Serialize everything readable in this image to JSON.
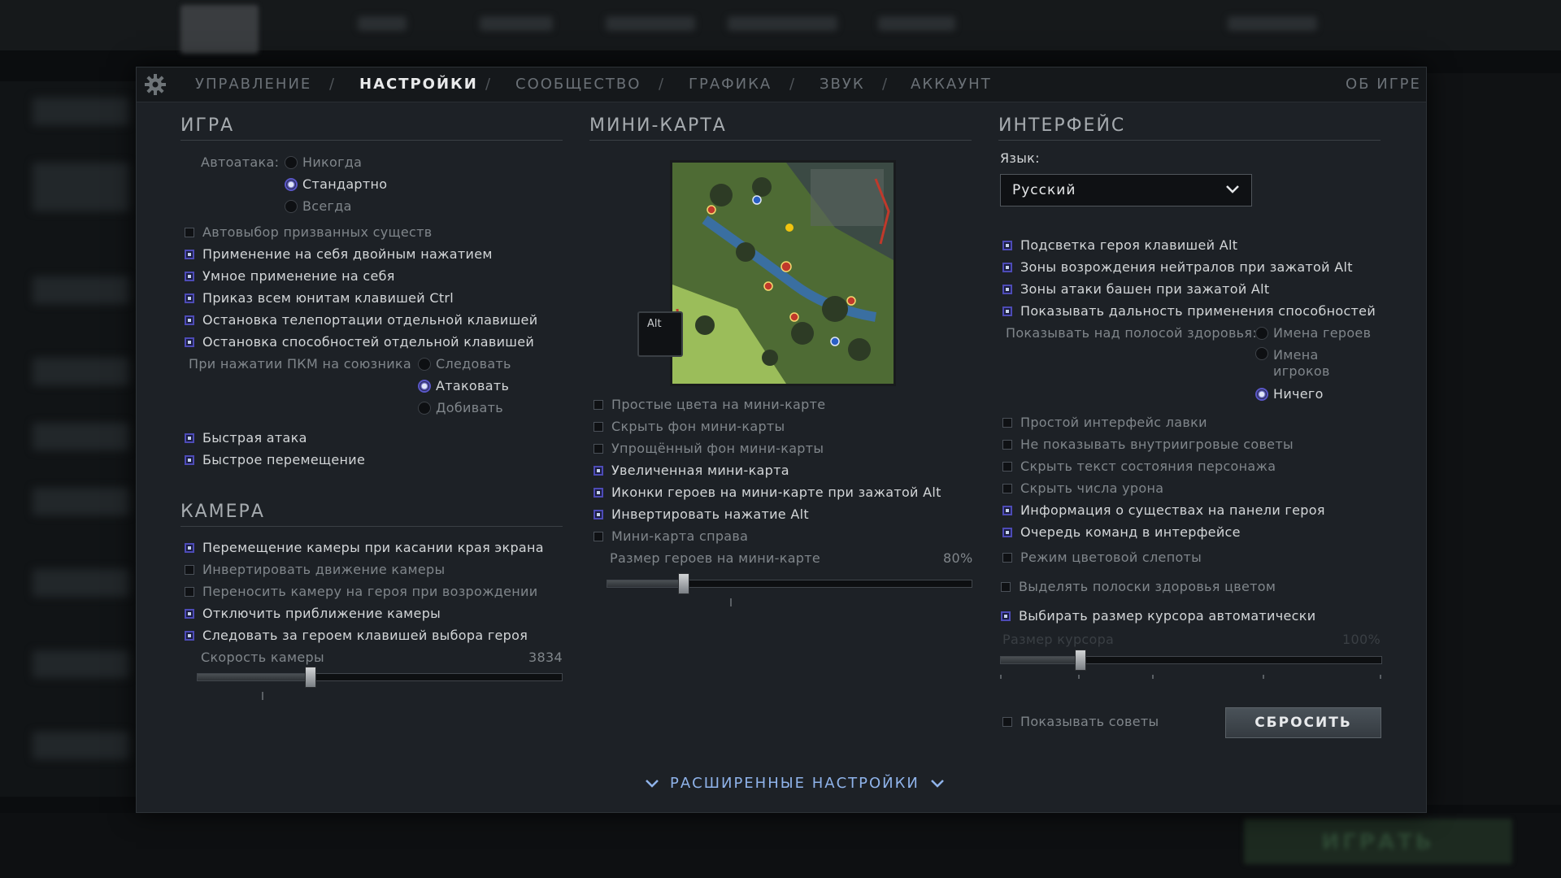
{
  "app": {
    "play_button": "ИГРАТЬ"
  },
  "tabs": {
    "items": [
      {
        "label": "УПРАВЛЕНИЕ",
        "active": false
      },
      {
        "label": "НАСТРОЙКИ",
        "active": true
      },
      {
        "label": "СООБЩЕСТВО",
        "active": false
      },
      {
        "label": "ГРАФИКА",
        "active": false
      },
      {
        "label": "ЗВУК",
        "active": false
      },
      {
        "label": "АККАУНТ",
        "active": false
      }
    ],
    "separator": "/",
    "about": "ОБ ИГРЕ"
  },
  "game": {
    "title": "ИГРА",
    "autoattack_label": "Автоатака:",
    "autoattack_options": [
      {
        "label": "Никогда",
        "selected": false
      },
      {
        "label": "Стандартно",
        "selected": true
      },
      {
        "label": "Всегда",
        "selected": false
      }
    ],
    "checks": [
      {
        "label": "Автовыбор призванных существ",
        "checked": false
      },
      {
        "label": "Применение на себя двойным нажатием",
        "checked": true
      },
      {
        "label": "Умное применение на себя",
        "checked": true
      },
      {
        "label": "Приказ всем юнитам клавишей Ctrl",
        "checked": true
      },
      {
        "label": "Остановка телепортации отдельной клавишей",
        "checked": true
      },
      {
        "label": "Остановка способностей отдельной клавишей",
        "checked": true
      }
    ],
    "rmb_label": "При нажатии ПКМ на союзника",
    "rmb_options": [
      {
        "label": "Следовать",
        "selected": false
      },
      {
        "label": "Атаковать",
        "selected": true
      },
      {
        "label": "Добивать",
        "selected": false
      }
    ],
    "checks2": [
      {
        "label": "Быстрая атака",
        "checked": true
      },
      {
        "label": "Быстрое перемещение",
        "checked": true
      }
    ]
  },
  "camera": {
    "title": "КАМЕРА",
    "checks": [
      {
        "label": "Перемещение камеры при касании края экрана",
        "checked": true
      },
      {
        "label": "Инвертировать движение камеры",
        "checked": false
      },
      {
        "label": "Переносить камеру на героя при возрождении",
        "checked": false
      },
      {
        "label": "Отключить приближение камеры",
        "checked": true
      },
      {
        "label": "Следовать за героем клавишей выбора героя",
        "checked": true
      }
    ],
    "speed_label": "Скорость камеры",
    "speed_value": "3834",
    "speed_fraction": 0.31
  },
  "minimap": {
    "title": "МИНИ-КАРТА",
    "alt_key": "Alt",
    "checks": [
      {
        "label": "Простые цвета на мини-карте",
        "checked": false
      },
      {
        "label": "Скрыть фон мини-карты",
        "checked": false
      },
      {
        "label": "Упрощённый фон мини-карты",
        "checked": false
      },
      {
        "label": "Увеличенная мини-карта",
        "checked": true
      },
      {
        "label": "Иконки героев на мини-карте при зажатой Alt",
        "checked": true
      },
      {
        "label": "Инвертировать нажатие Alt",
        "checked": true
      },
      {
        "label": "Мини-карта справа",
        "checked": false
      }
    ],
    "hero_size_label": "Размер героев на мини-карте",
    "hero_size_value": "80%",
    "hero_size_fraction": 0.21
  },
  "interface": {
    "title": "ИНТЕРФЕЙС",
    "language_label": "Язык:",
    "language_value": "Русский",
    "checks": [
      {
        "label": "Подсветка героя клавишей Alt",
        "checked": true
      },
      {
        "label": "Зоны возрождения нейтралов при зажатой Alt",
        "checked": true
      },
      {
        "label": "Зоны атаки башен при зажатой Alt",
        "checked": true
      },
      {
        "label": "Показывать дальность применения способностей",
        "checked": true
      }
    ],
    "healthbar_label": "Показывать над полосой здоровья:",
    "healthbar_options": [
      {
        "label": "Имена героев",
        "selected": false
      },
      {
        "label": "Имена игроков",
        "selected": false
      },
      {
        "label": "Ничего",
        "selected": true
      }
    ],
    "checks2": [
      {
        "label": "Простой интерфейс лавки",
        "checked": false
      },
      {
        "label": "Не показывать внутриигровые советы",
        "checked": false
      },
      {
        "label": "Скрыть текст состояния персонажа",
        "checked": false
      },
      {
        "label": "Скрыть числа урона",
        "checked": false
      },
      {
        "label": "Информация о существах на панели героя",
        "checked": true
      },
      {
        "label": "Очередь команд в интерфейсе",
        "checked": true
      },
      {
        "label": "Режим цветовой слепоты",
        "checked": false
      },
      {
        "label": "Выделять полоски здоровья цветом",
        "checked": false
      },
      {
        "label": "Выбирать размер курсора автоматически",
        "checked": true
      }
    ],
    "cursor_size_label": "Размер курсора",
    "cursor_size_value": "100%",
    "cursor_size_fraction": 0.21,
    "show_tips_label": "Показывать советы",
    "show_tips_checked": false,
    "reset_button": "СБРОСИТЬ"
  },
  "advanced": {
    "label": "РАСШИРЕННЫЕ НАСТРОЙКИ"
  },
  "icons": {
    "settings": "gear-icon",
    "dropdown": "chevron-down-icon",
    "advanced": "chevron-down-icon"
  },
  "colors": {
    "accent": "#8fb3ea",
    "checked_border": "#4d4bb6",
    "panel_bg": "#1d2126"
  }
}
